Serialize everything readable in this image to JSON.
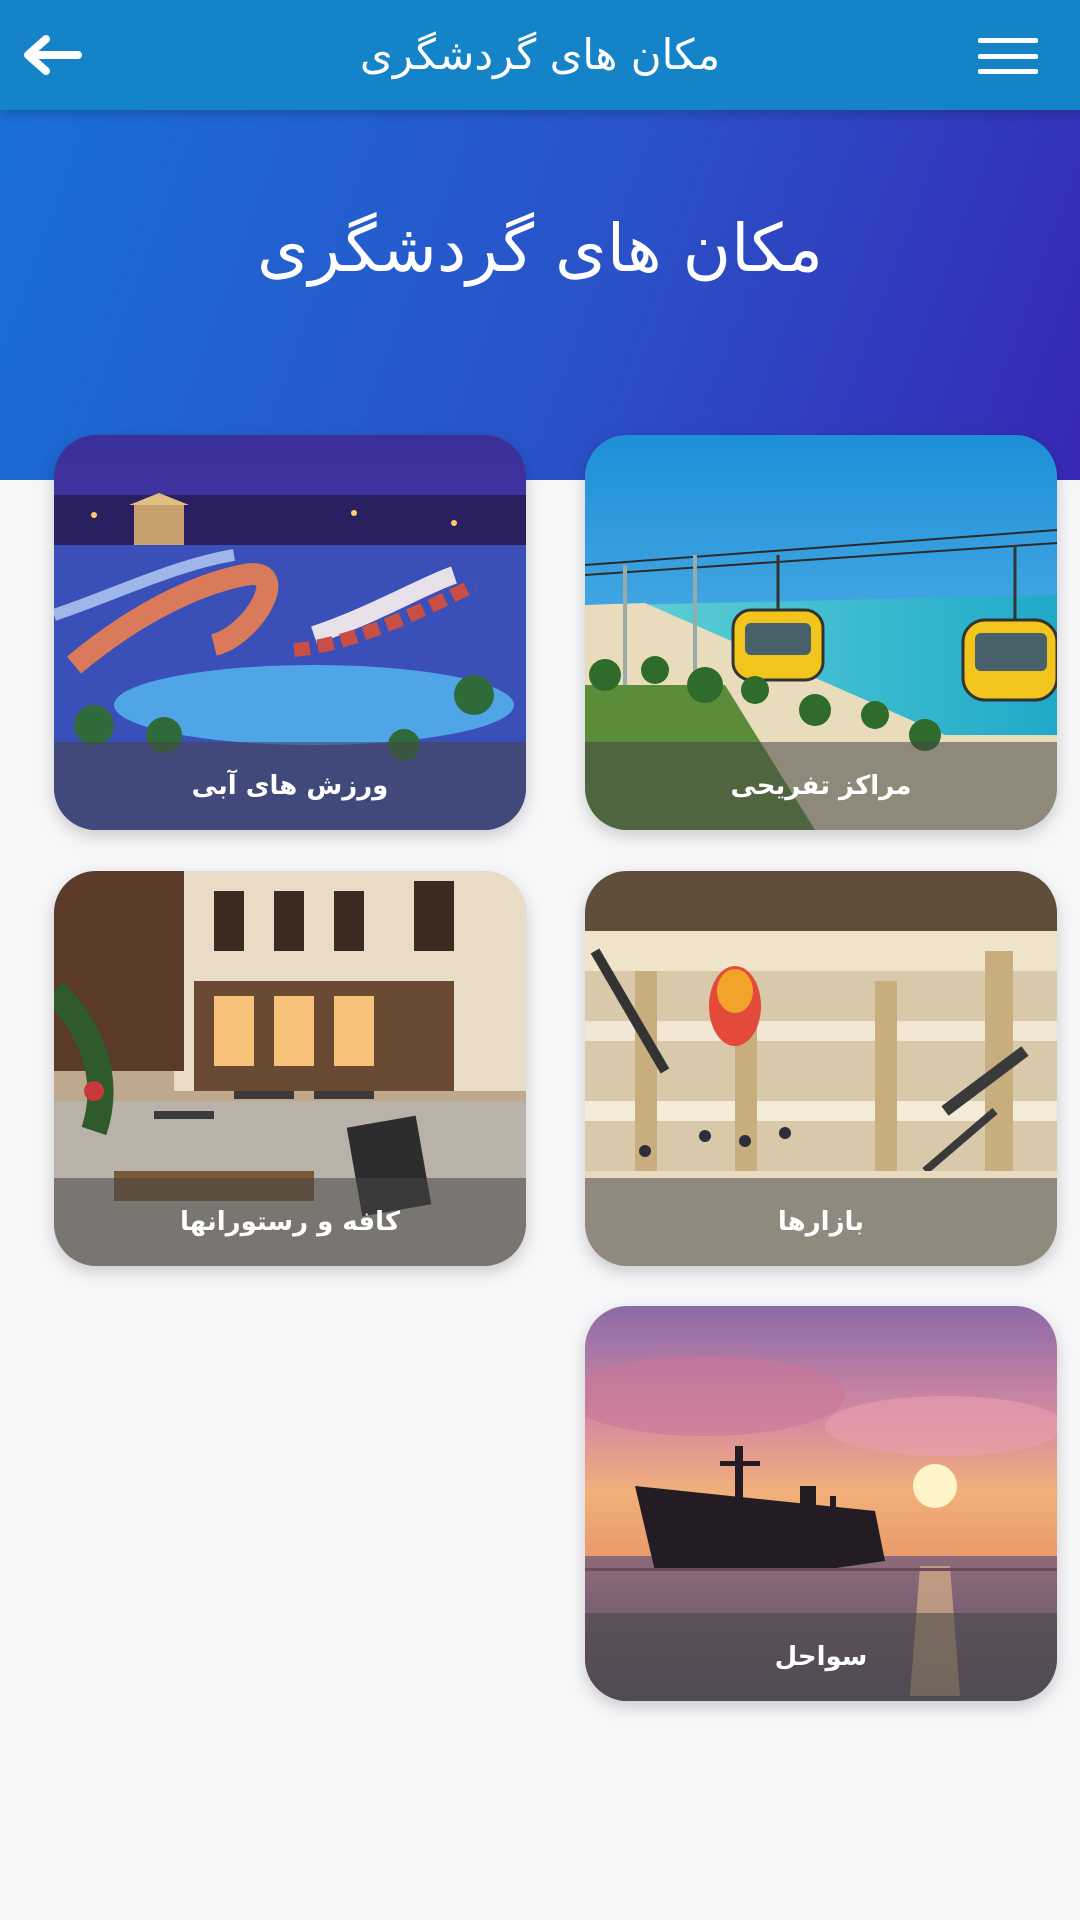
{
  "appbar": {
    "title": "مکان های گردشگری",
    "back_icon": "arrow-left-icon",
    "menu_icon": "hamburger-menu-icon"
  },
  "hero": {
    "heading": "مکان های گردشگری"
  },
  "categories": [
    {
      "label": "مراکز تفریحی"
    },
    {
      "label": "ورزش های آبی"
    },
    {
      "label": "بازارها"
    },
    {
      "label": "کافه و رستورانها"
    },
    {
      "label": "سواحل"
    }
  ],
  "colors": {
    "appbar": "#1583c8",
    "hero_start": "#1a6fd6",
    "hero_end": "#3628b4",
    "background": "#f7f7f9"
  }
}
